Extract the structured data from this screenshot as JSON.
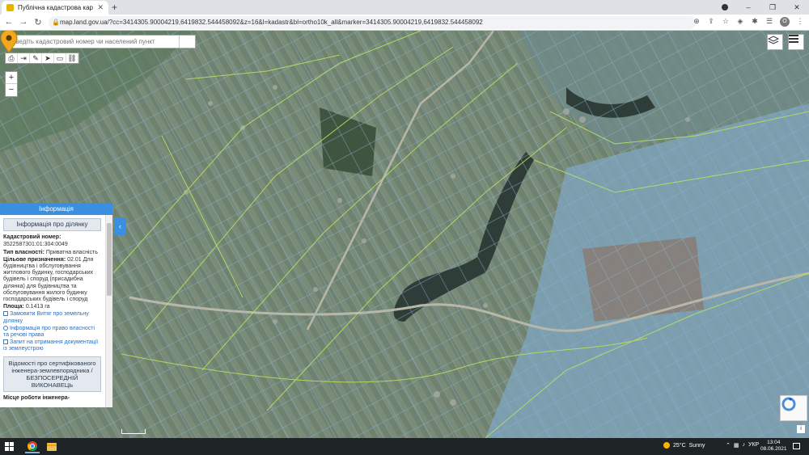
{
  "browser": {
    "tab_title": "Публічна кадастрова карта Укр...",
    "tab_close": "✕",
    "new_tab": "+",
    "url": "map.land.gov.ua/?cc=3414305.90004219,6419832.544458092&z=16&l=kadastr&bl=ortho10k_all&marker=3414305.90004219,6419832.544458092",
    "profile_letter": "O",
    "win_min": "–",
    "win_max": "❐",
    "win_close": "✕"
  },
  "map": {
    "search_placeholder": "Введіть кадастровий номер чи населений пункт"
  },
  "panel": {
    "header": "Інформація",
    "section_title": "Інформація про ділянку",
    "cadastral_label": "Кадастровий номер:",
    "cadastral_value": "3522587301:01:304:0049",
    "ownership_label": "Тип власності:",
    "ownership_value": "Приватна власність",
    "purpose_label": "Цільове призначення:",
    "purpose_value": "02.01 Для будівництва і обслуговування житлового будинку, господарських будівель і споруд (присадибна ділянка) для будівництва та обслуговування жилого будинку господарських будівель і споруд",
    "area_label": "Площа:",
    "area_value": "0.1413 га",
    "link1": "Замовити Витяг про земельну ділянку",
    "link2": "Інформація про право власності та речові права",
    "link3": "Запит на отримання документації із землеустрою",
    "cert_box": "Відомості про сертифікованого інженера-землевпорядника / БЕЗПОСЕРЕДНІЙ ВИКОНАВЕЦЬ",
    "work_place": "Місце роботи інженера-",
    "collapse_arrow": "‹"
  },
  "taskbar": {
    "temp": "25°C",
    "weather": "Sunny",
    "lang": "УКР",
    "time": "13:04",
    "date": "08.06.2021"
  }
}
